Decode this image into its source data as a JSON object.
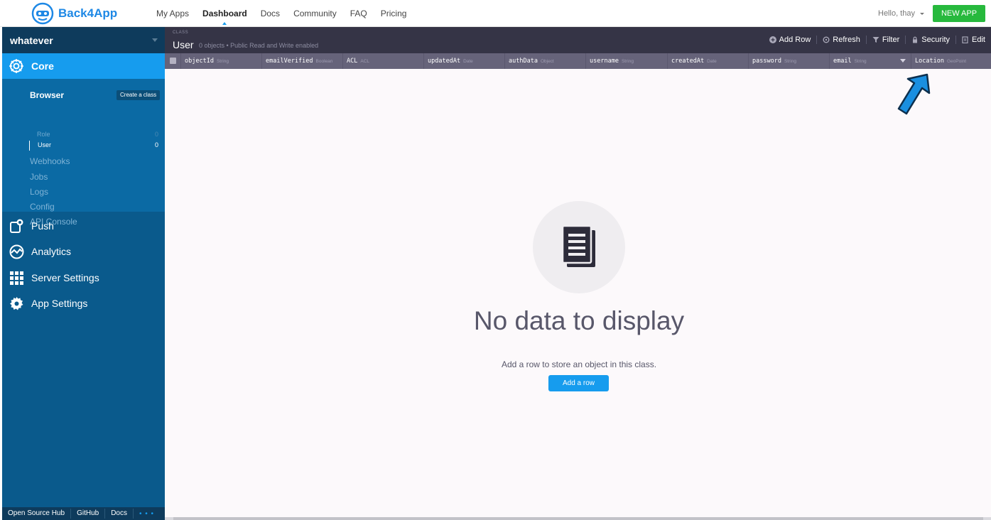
{
  "brand": {
    "name": "Back4App"
  },
  "nav": {
    "links": [
      "My Apps",
      "Dashboard",
      "Docs",
      "Community",
      "FAQ",
      "Pricing"
    ],
    "greeting": "Hello, thay",
    "new_app": "NEW APP"
  },
  "sidebar": {
    "app_name": "whatever",
    "core": {
      "label": "Core",
      "browser": "Browser",
      "create_class": "Create a class",
      "classes": [
        {
          "name": "Role",
          "count": "0"
        },
        {
          "name": "User",
          "count": "0"
        }
      ],
      "items": [
        "Webhooks",
        "Jobs",
        "Logs",
        "Config",
        "API Console"
      ]
    },
    "sections": [
      "Push",
      "Analytics",
      "Server Settings",
      "App Settings"
    ],
    "footer": [
      "Open Source Hub",
      "GitHub",
      "Docs"
    ]
  },
  "toolbar": {
    "caption": "CLASS",
    "class_name": "User",
    "subtitle": "0 objects • Public Read and Write enabled",
    "actions": [
      "Add Row",
      "Refresh",
      "Filter",
      "Security",
      "Edit"
    ]
  },
  "columns": [
    {
      "name": "objectId",
      "type": "String"
    },
    {
      "name": "emailVerified",
      "type": "Boolean"
    },
    {
      "name": "ACL",
      "type": "ACL"
    },
    {
      "name": "updatedAt",
      "type": "Date"
    },
    {
      "name": "authData",
      "type": "Object"
    },
    {
      "name": "username",
      "type": "String"
    },
    {
      "name": "createdAt",
      "type": "Date"
    },
    {
      "name": "password",
      "type": "String"
    },
    {
      "name": "email",
      "type": "String"
    },
    {
      "name": "Location",
      "type": "GeoPoint"
    }
  ],
  "empty_state": {
    "title": "No data to display",
    "description": "Add a row to store an object in this class.",
    "button": "Add a row"
  },
  "colors": {
    "primary": "#169cee",
    "sidebar": "#0a5a8c",
    "toolbar": "#353446",
    "new_app": "#27b93d"
  }
}
